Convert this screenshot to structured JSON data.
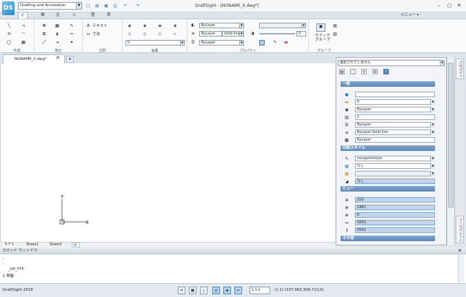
{
  "app": {
    "title": "DraftSight - [NONAME_0.dwg*]",
    "name": "DraftSight 2018",
    "logo": "DS",
    "menu_label": "メニュー ▾",
    "workspace": "Drafting and Annotation"
  },
  "ribbon": {
    "tabs": [
      "ホーム",
      "挿入",
      "注釈",
      "シート",
      "管理",
      "表示"
    ],
    "groups": {
      "draw": "作成",
      "modify": "修正",
      "annotate": "注釈",
      "layers": "画層",
      "properties": "プロパティ",
      "group": "グループ"
    },
    "text_label": "テキスト",
    "dimension_label": "寸法",
    "layer_value": "0",
    "color_value": "ByLayer",
    "linetype_value": "ByLayer",
    "linestyle_value": "Solid line",
    "lineweight_value": "ByLayer",
    "transparency_value": "0",
    "quick_group_label": "クイック\nグループ"
  },
  "document": {
    "tab": "NONAME_0.dwg*",
    "layout_tabs": [
      "モデル",
      "Sheet1",
      "Sheet2"
    ],
    "ucs_y": "Y",
    "ucs_x": "X"
  },
  "properties": {
    "selector": "選択されていません",
    "sections": {
      "general": "一般",
      "print_style": "印刷スタイル",
      "view": "ビュー",
      "misc": "その他"
    },
    "general_rows": [
      "",
      "0",
      "ByLayer",
      "1",
      "ByLayer",
      "ByLayer      Solid line",
      "ByLayer"
    ],
    "print_rows": [
      "noneprintstyle",
      "なし",
      "",
      "なし"
    ],
    "view_rows": [
      "210",
      "1461",
      "0",
      "4241",
      "0552"
    ],
    "side_tabs": [
      "プロパティ",
      "ツールパレット"
    ]
  },
  "command": {
    "header": "コマンド ウィンドウ",
    "lines": [
      ":",
      ":",
      "_DP_FTP",
      "1 移動"
    ]
  },
  "status": {
    "scale": "(1:1)",
    "scale_label": "1:1",
    "coords": "(337.063,309.713,0)"
  },
  "colors": {
    "accent": "#2a86c8",
    "section_header": "#5e89b8",
    "field_blue": "#bfd6ee"
  }
}
